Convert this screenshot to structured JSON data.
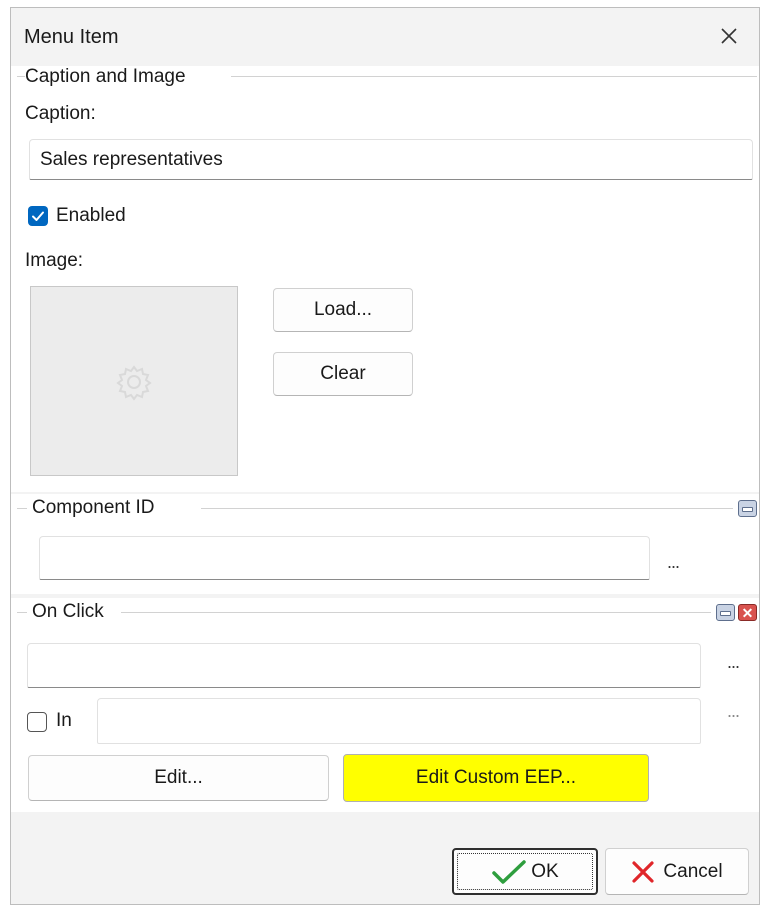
{
  "window": {
    "title": "Menu Item",
    "close_icon": "close-icon"
  },
  "caption_section": {
    "legend": "Caption and Image",
    "caption_label": "Caption:",
    "caption_value": "Sales representatives",
    "enabled_label": "Enabled",
    "enabled_checked": true,
    "image_label": "Image:",
    "image_placeholder_icon": "gear-icon",
    "load_button": "Load...",
    "clear_button": "Clear"
  },
  "component_id_section": {
    "legend": "Component ID",
    "value": "",
    "browse": "..."
  },
  "on_click_section": {
    "legend": "On Click",
    "value": "",
    "browse": "...",
    "in_label": "In",
    "in_checked": false,
    "in_value": "",
    "in_browse": "...",
    "edit_button": "Edit...",
    "edit_custom_button": "Edit Custom EEP...",
    "edit_custom_color": "#ffff00"
  },
  "footer": {
    "ok_button": "OK",
    "cancel_button": "Cancel",
    "ok_icon": "checkmark-icon",
    "cancel_icon": "x-icon",
    "ok_icon_color": "#2e9e3e",
    "cancel_icon_color": "#e0262a"
  }
}
